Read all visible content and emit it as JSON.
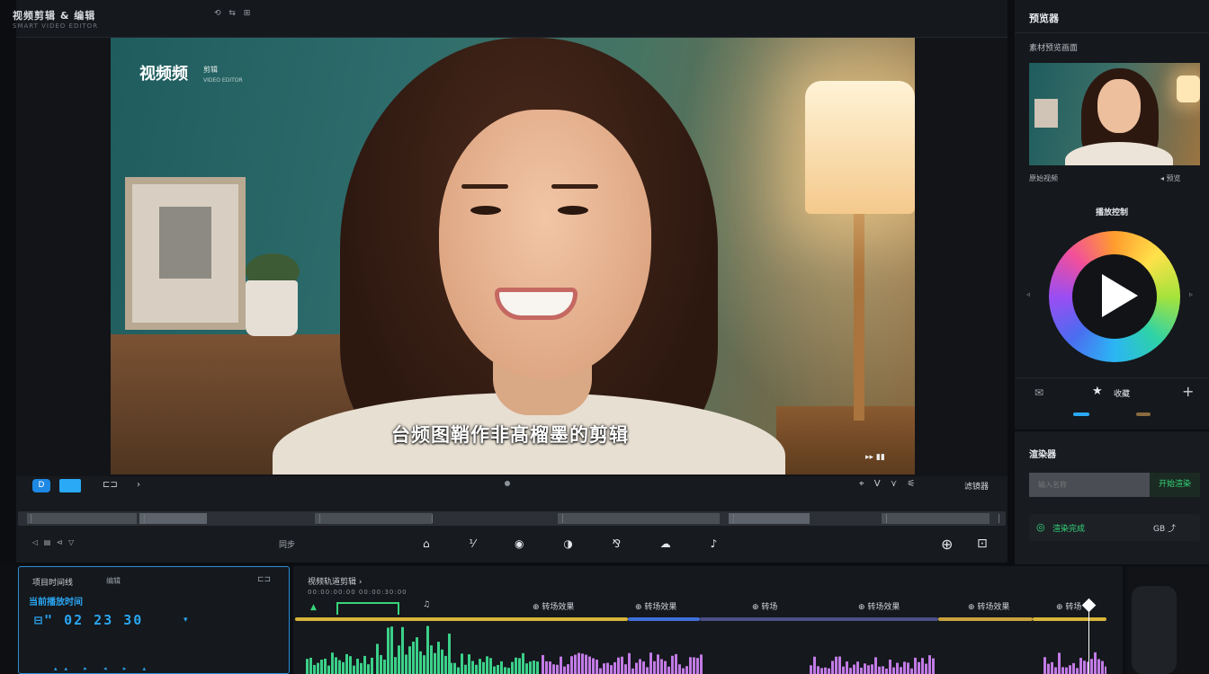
{
  "header": {
    "title": "视频剪辑 & 编辑",
    "subtitle": "SMART VIDEO EDITOR",
    "icons_text": "⟲ ⇆ ⊞"
  },
  "viewer": {
    "badge_title": "视频频",
    "badge_sub": "剪辑",
    "badge_sub2": "VIDEO EDITOR",
    "subtitle": "台频图鞘作非髙榴墨的剪辑",
    "corner": "▸▸  ▮▮"
  },
  "transport": {
    "link_label": "D",
    "screen_icon": "⊏⊐",
    "arrow_icon": "›",
    "right_tools": "⌖ V ⋎ ⚟",
    "right_label": "滤镜器",
    "lower_left": "◁ ▤ ⊲ ▽",
    "lower_mid": "同步",
    "center_icons": "⌂ ⅟ ◉ ◑ ⅋ ☁ ♪",
    "crosshair_icon": "⊕",
    "save_icon": "⊡"
  },
  "sidebar": {
    "title": "预览器",
    "sub": "素材预览画面",
    "thumb_label_left": "原始视频",
    "thumb_label_right": "◂ 预览",
    "wheel_title": "播放控制",
    "wheel_left": "◃",
    "wheel_right": "▹",
    "star_label": "收藏",
    "render_title": "渲染器",
    "render_placeholder": "输入名称",
    "render_button": "开始渲染",
    "status_icon": "◎",
    "status_text": "渲染完成",
    "status_right": "GB ⤴"
  },
  "timecode": {
    "title": "项目时间线",
    "title2": "编辑",
    "corner": "⊏⊐",
    "blue_label": "当前播放时间",
    "value": "⊟\" 02  23  30",
    "arrow": "▾",
    "bottom": "▴▴ ▸ ◂ ▸ ▴"
  },
  "timeline": {
    "title": "视频轨道剪辑  ›",
    "sub": "00:00:00:00  00:00:30:00",
    "labels": [
      "♫",
      "⊕ 转场效果",
      "⊕ 转场效果",
      "⊕ 转场",
      "⊕ 转场效果",
      "⊕ 转场效果",
      "⊕ 转场"
    ],
    "green_mark": "▲"
  },
  "colors": {
    "accent_blue": "#29a9f6",
    "green": "#39d37b",
    "purple": "#c27be6",
    "panel": "#15181c"
  }
}
